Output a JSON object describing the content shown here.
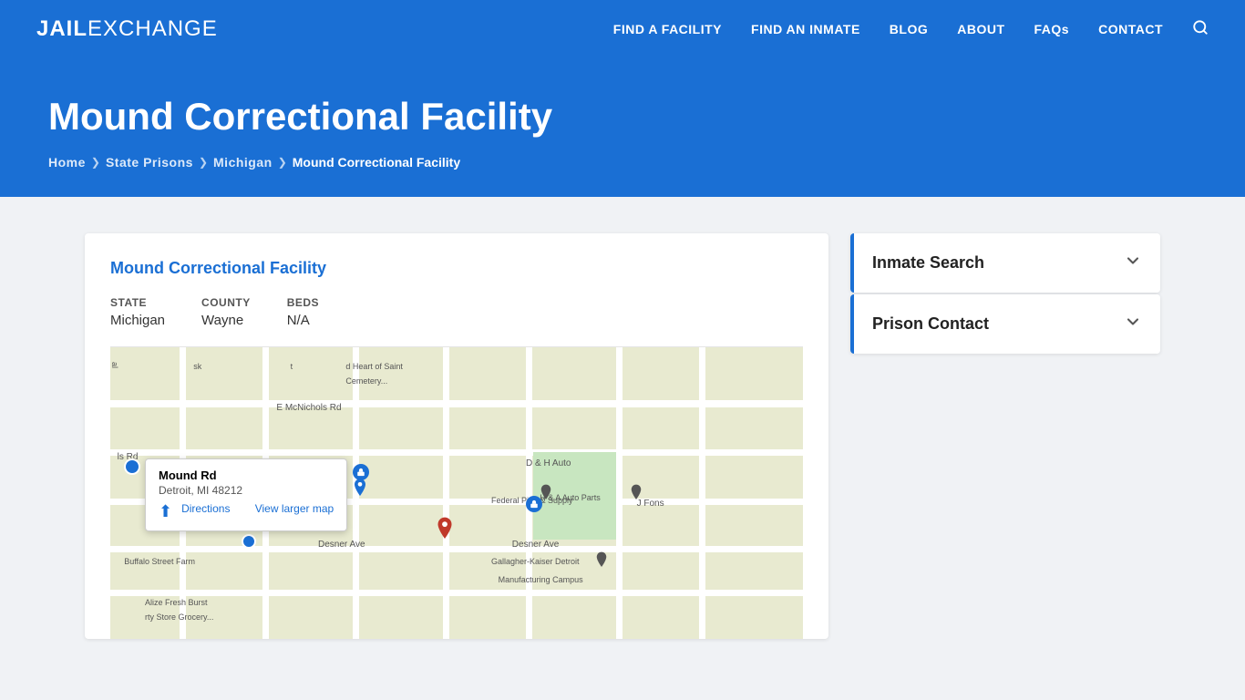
{
  "header": {
    "logo_bold": "JAIL",
    "logo_light": "EXCHANGE",
    "nav": [
      {
        "label": "FIND A FACILITY",
        "href": "#"
      },
      {
        "label": "FIND AN INMATE",
        "href": "#"
      },
      {
        "label": "BLOG",
        "href": "#"
      },
      {
        "label": "ABOUT",
        "href": "#"
      },
      {
        "label": "FAQs",
        "href": "#"
      },
      {
        "label": "CONTACT",
        "href": "#"
      }
    ]
  },
  "hero": {
    "title": "Mound Correctional Facility",
    "breadcrumb": [
      {
        "label": "Home",
        "href": "#"
      },
      {
        "label": "State Prisons",
        "href": "#"
      },
      {
        "label": "Michigan",
        "href": "#"
      },
      {
        "label": "Mound Correctional Facility",
        "current": true
      }
    ]
  },
  "facility": {
    "name": "Mound Correctional Facility",
    "state_label": "STATE",
    "state_value": "Michigan",
    "county_label": "COUNTY",
    "county_value": "Wayne",
    "beds_label": "BEDS",
    "beds_value": "N/A"
  },
  "map": {
    "popup_title": "Mound Rd",
    "popup_address": "Detroit, MI 48212",
    "directions_label": "Directions",
    "view_larger_label": "View larger map"
  },
  "sidebar": {
    "inmate_search_label": "Inmate Search",
    "prison_contact_label": "Prison Contact",
    "chevron": "⌄"
  }
}
